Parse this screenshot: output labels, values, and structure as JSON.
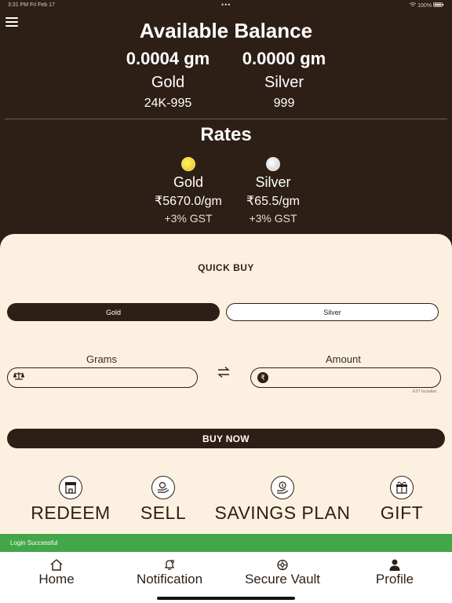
{
  "status_bar": {
    "time": "3:31 PM",
    "date": "Fri Feb 17",
    "dots": "•••",
    "battery": "100%"
  },
  "balance": {
    "title": "Available Balance",
    "gold": {
      "amount": "0.0004 gm",
      "name": "Gold",
      "purity": "24K-995"
    },
    "silver": {
      "amount": "0.0000 gm",
      "name": "Silver",
      "purity": "999"
    }
  },
  "rates": {
    "title": "Rates",
    "gold": {
      "name": "Gold",
      "price": "₹5670.0/gm",
      "gst": "+3% GST"
    },
    "silver": {
      "name": "Silver",
      "price": "₹65.5/gm",
      "gst": "+3% GST"
    }
  },
  "quick_buy": {
    "title": "QUICK BUY",
    "metal_options": [
      "Gold",
      "Silver"
    ],
    "selected_metal": "Gold",
    "grams_label": "Grams",
    "grams_value": "",
    "amount_label": "Amount",
    "amount_value": "",
    "gst_note": "GST Included",
    "buy_button": "BUY NOW"
  },
  "actions": [
    {
      "label": "REDEEM",
      "icon": "store-icon"
    },
    {
      "label": "SELL",
      "icon": "hand-coin-icon"
    },
    {
      "label": "SAVINGS PLAN",
      "icon": "savings-icon"
    },
    {
      "label": "GIFT",
      "icon": "gift-icon"
    }
  ],
  "toast": "Login Successful",
  "tabs": [
    {
      "label": "Home",
      "icon": "home-icon"
    },
    {
      "label": "Notification",
      "icon": "bell-icon"
    },
    {
      "label": "Secure Vault",
      "icon": "vault-icon"
    },
    {
      "label": "Profile",
      "icon": "profile-icon"
    }
  ],
  "colors": {
    "primary": "#2d1f16",
    "panel": "#fcf1e1",
    "toast": "#43a649",
    "gold_coin": "#f2d22e",
    "silver_coin": "#e0e0e0"
  }
}
